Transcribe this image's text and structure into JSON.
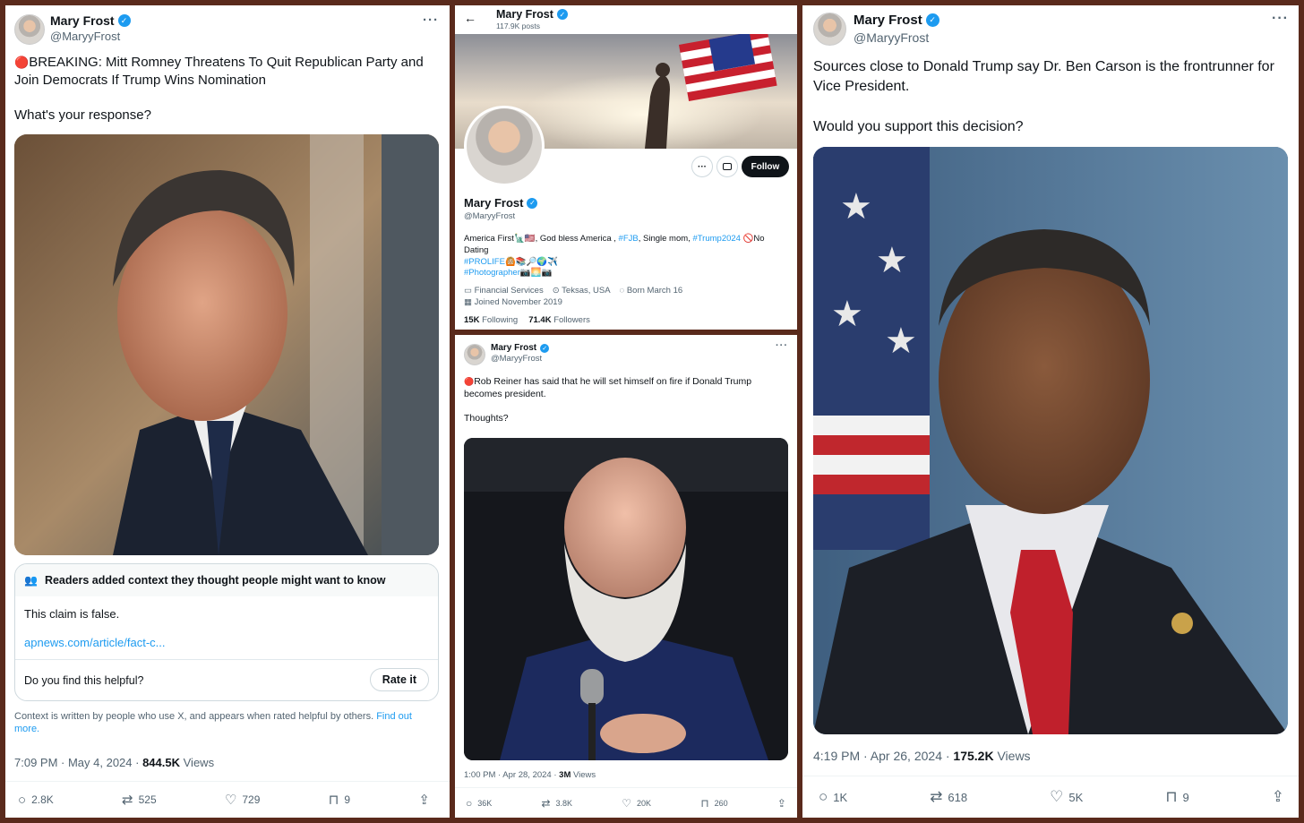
{
  "tweet1": {
    "name": "Mary Frost",
    "handle": "@MaryyFrost",
    "text": "BREAKING: Mitt Romney Threatens To Quit Republican Party and Join Democrats If Trump Wins Nomination\n\nWhat's your response?",
    "note": {
      "header": "Readers added context they thought people might want to know",
      "body": "This claim is false.",
      "link": "apnews.com/article/fact-c...",
      "question": "Do you find this helpful?",
      "rate": "Rate it",
      "footer": "Context is written by people who use X, and appears when rated helpful by others.",
      "find_out": "Find out more."
    },
    "time": "7:09 PM · May 4, 2024 ·",
    "views_count": "844.5K",
    "views_label": "Views",
    "replies": "2.8K",
    "reposts": "525",
    "likes": "729",
    "bookmarks": "9"
  },
  "profile": {
    "name": "Mary Frost",
    "posts": "117.9K posts",
    "handle": "@MaryyFrost",
    "follow": "Follow",
    "bio_1a": "America First🗽🇺🇸, God bless America , ",
    "bio_1b": "#FJB",
    "bio_1c": ", Single mom, ",
    "bio_1d": "#Trump2024",
    "bio_1e": " 🚫No Dating",
    "bio_2": "#PROLIFE",
    "bio_2e": "🙆🏼📚🔎🌍✈️",
    "bio_3": "#Photographer",
    "bio_3e": "📷🌅📷",
    "category": "Financial Services",
    "location": "Teksas, USA",
    "born": "Born March 16",
    "joined": "Joined November 2019",
    "following_count": "15K",
    "following_label": "Following",
    "followers_count": "71.4K",
    "followers_label": "Followers"
  },
  "tweet3": {
    "name": "Mary Frost",
    "handle": "@MaryyFrost",
    "text": "Rob Reiner has said that he will set himself on fire if Donald Trump becomes president.\n\nThoughts?",
    "time": "1:00 PM · Apr 28, 2024 ·",
    "views_count": "3M",
    "views_label": "Views",
    "replies": "36K",
    "reposts": "3.8K",
    "likes": "20K",
    "bookmarks": "260"
  },
  "tweet4": {
    "name": "Mary Frost",
    "handle": "@MaryyFrost",
    "text": "Sources close to Donald Trump say Dr. Ben Carson is the frontrunner for Vice President.\n\nWould you support this decision?",
    "time": "4:19 PM · Apr 26, 2024 ·",
    "views_count": "175.2K",
    "views_label": "Views",
    "replies": "1K",
    "reposts": "618",
    "likes": "5K",
    "bookmarks": "9"
  },
  "icons": {
    "more": "···",
    "verified": "✓",
    "back": "←",
    "red_circle": "🔴",
    "community": "👥",
    "reply": "○",
    "repost": "⇄",
    "like": "♡",
    "bookmark": "⊓",
    "share": "⇪"
  },
  "colors": {
    "accent": "#1d9bf0",
    "frame": "#5a2a1c"
  }
}
